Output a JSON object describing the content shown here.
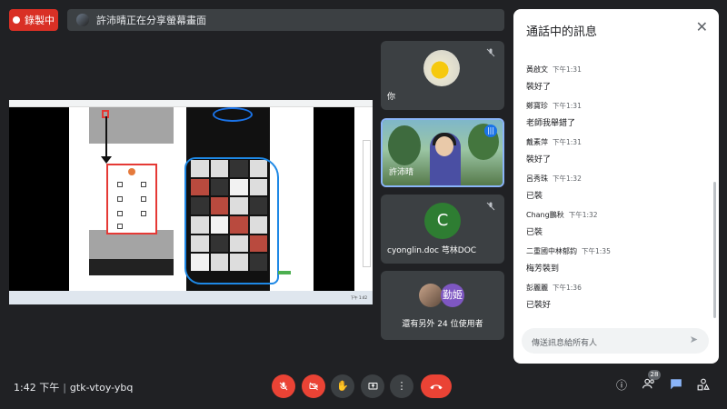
{
  "recording": {
    "label": "錄製中"
  },
  "presenting": {
    "text": "許沛晴正在分享螢幕畫面"
  },
  "shared_screen": {
    "taskbar_time": "下午 1:42"
  },
  "tiles": [
    {
      "name": "你"
    },
    {
      "name": "許沛晴"
    },
    {
      "name": "cyonglin.doc 芎林DOC",
      "initial": "C"
    },
    {
      "name": "還有另外 24 位使用者",
      "avatar_label": "勤姬"
    }
  ],
  "chat": {
    "title": "通話中的訊息",
    "messages": [
      {
        "sender": "黃啟文",
        "time": "下午1:31",
        "text": "裝好了"
      },
      {
        "sender": "鄭寶珍",
        "time": "下午1:31",
        "text": "老師我舉錯了"
      },
      {
        "sender": "戴素萍",
        "time": "下午1:31",
        "text": "裝好了"
      },
      {
        "sender": "呂秀珠",
        "time": "下午1:32",
        "text": "已裝"
      },
      {
        "sender": "Chang鵬秋",
        "time": "下午1:32",
        "text": "已裝"
      },
      {
        "sender": "二重國中林郁鈞",
        "time": "下午1:35",
        "text": "梅芳裝到"
      },
      {
        "sender": "彭麗麗",
        "time": "下午1:36",
        "text": "已裝好"
      }
    ],
    "input_placeholder": "傳送訊息給所有人"
  },
  "footer": {
    "time": "1:42 下午",
    "meeting_code": "gtk-vtoy-ybq",
    "people_count": "28"
  },
  "icons": [
    "record-dot-icon",
    "mic-off-icon",
    "camera-off-icon",
    "raise-hand-icon",
    "present-icon",
    "more-icon",
    "hangup-icon",
    "info-icon",
    "people-icon",
    "chat-icon",
    "activities-icon",
    "send-icon",
    "close-icon"
  ],
  "colors": {
    "danger": "#ea4335",
    "accent": "#1a73e8",
    "panel": "#3c4043",
    "bg": "#202124"
  }
}
